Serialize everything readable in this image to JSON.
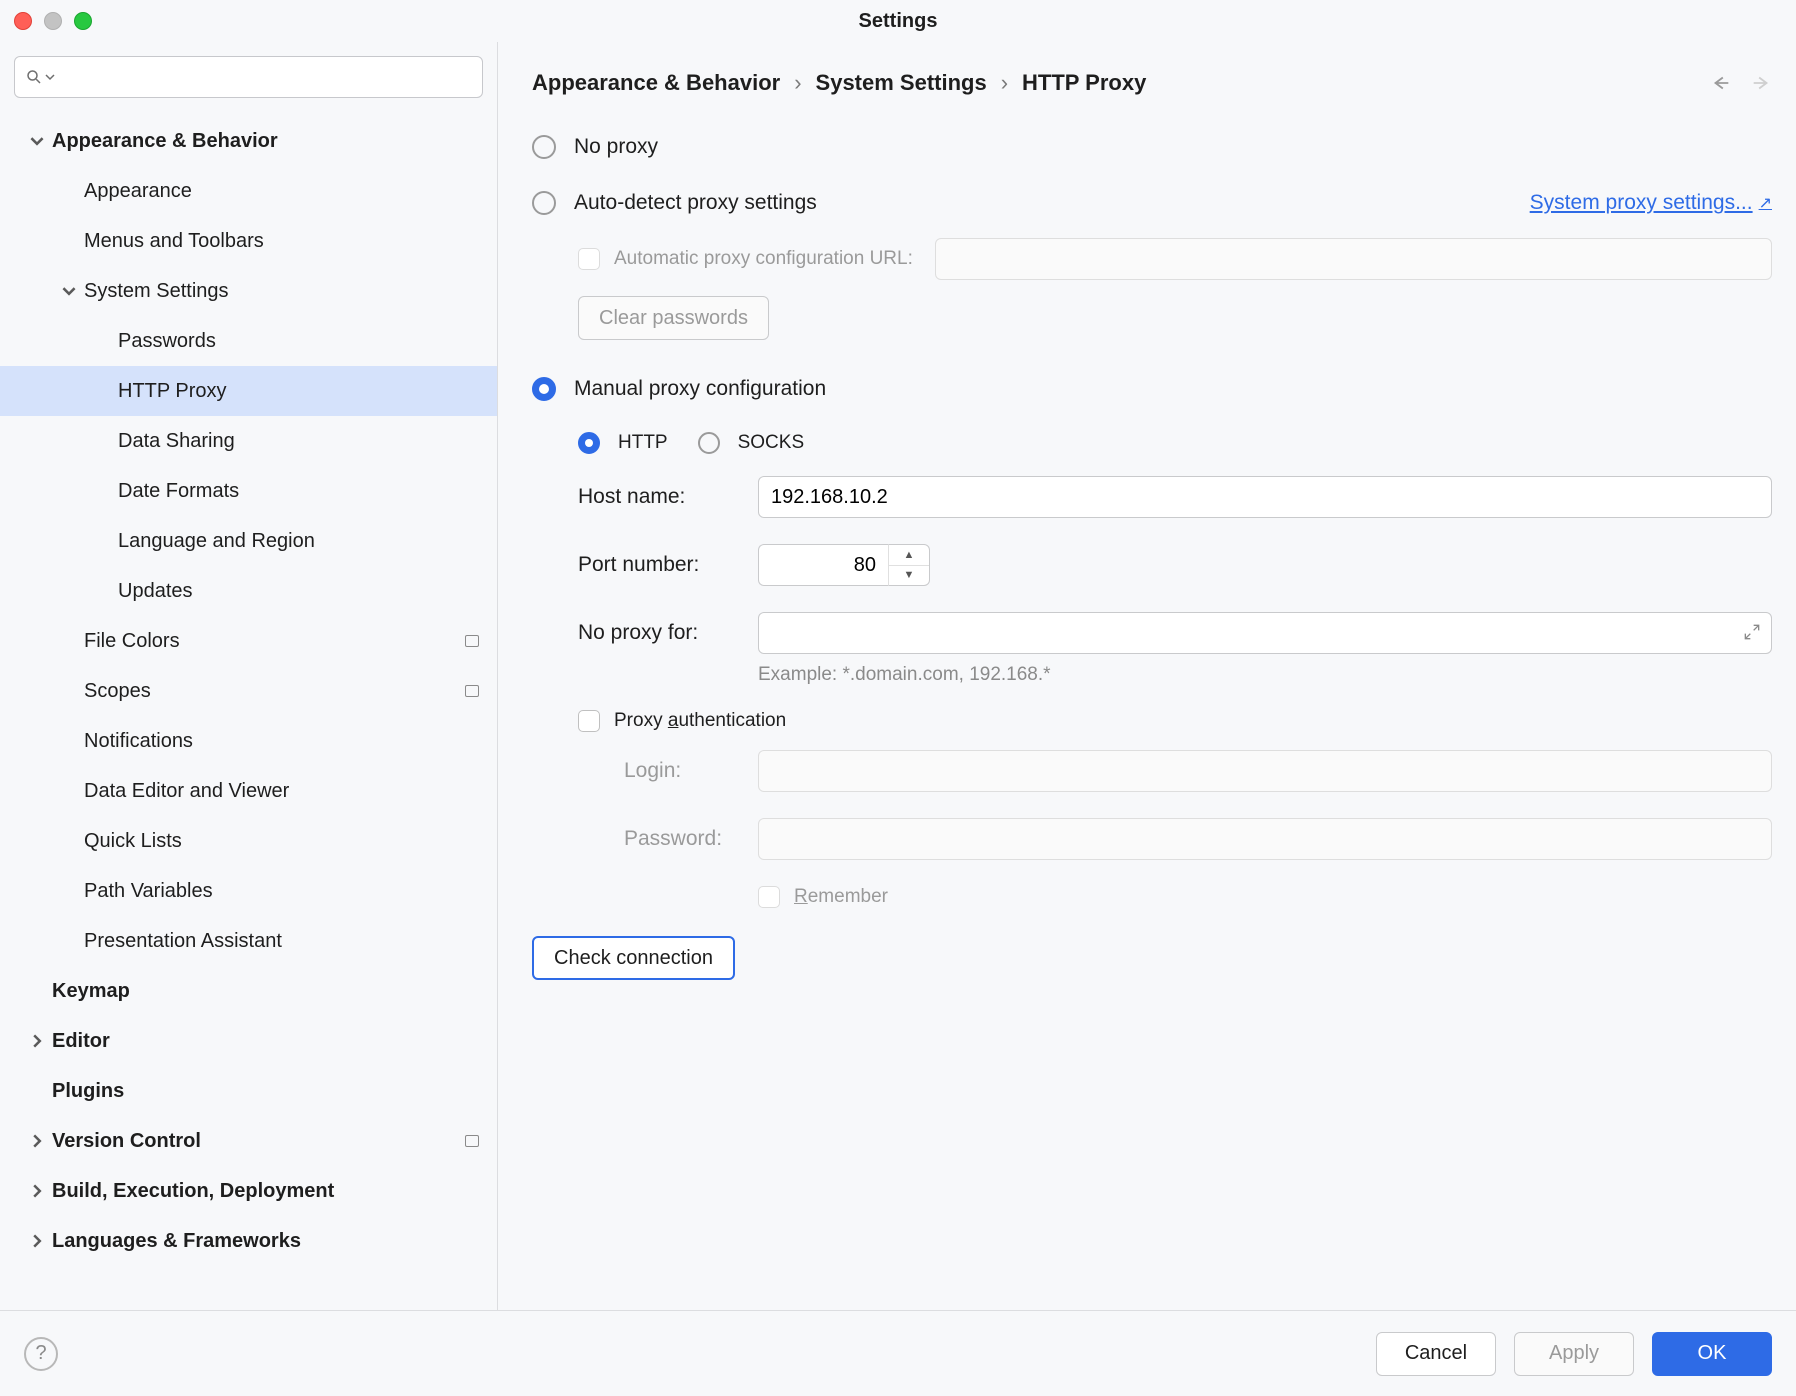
{
  "window": {
    "title": "Settings"
  },
  "sidebar": {
    "search_placeholder": "",
    "items": [
      {
        "label": "Appearance & Behavior",
        "bold": true,
        "indent": 0,
        "chev": "down"
      },
      {
        "label": "Appearance",
        "indent": 1
      },
      {
        "label": "Menus and Toolbars",
        "indent": 1
      },
      {
        "label": "System Settings",
        "indent": 1,
        "chev": "down"
      },
      {
        "label": "Passwords",
        "indent": 2
      },
      {
        "label": "HTTP Proxy",
        "indent": 2,
        "selected": true
      },
      {
        "label": "Data Sharing",
        "indent": 2
      },
      {
        "label": "Date Formats",
        "indent": 2
      },
      {
        "label": "Language and Region",
        "indent": 2
      },
      {
        "label": "Updates",
        "indent": 2
      },
      {
        "label": "File Colors",
        "indent": 1,
        "badge": true
      },
      {
        "label": "Scopes",
        "indent": 1,
        "badge": true
      },
      {
        "label": "Notifications",
        "indent": 1
      },
      {
        "label": "Data Editor and Viewer",
        "indent": 1
      },
      {
        "label": "Quick Lists",
        "indent": 1
      },
      {
        "label": "Path Variables",
        "indent": 1
      },
      {
        "label": "Presentation Assistant",
        "indent": 1
      },
      {
        "label": "Keymap",
        "bold": true,
        "indent": 0
      },
      {
        "label": "Editor",
        "bold": true,
        "indent": 0,
        "chev": "right"
      },
      {
        "label": "Plugins",
        "bold": true,
        "indent": 0
      },
      {
        "label": "Version Control",
        "bold": true,
        "indent": 0,
        "chev": "right",
        "badge": true
      },
      {
        "label": "Build, Execution, Deployment",
        "bold": true,
        "indent": 0,
        "chev": "right"
      },
      {
        "label": "Languages & Frameworks",
        "bold": true,
        "indent": 0,
        "chev": "right"
      }
    ]
  },
  "breadcrumbs": [
    "Appearance & Behavior",
    "System Settings",
    "HTTP Proxy"
  ],
  "proxy": {
    "no_proxy_label": "No proxy",
    "auto_detect_label": "Auto-detect proxy settings",
    "system_proxy_link": "System proxy settings...",
    "pac_checkbox_label": "Automatic proxy configuration URL:",
    "clear_passwords_label": "Clear passwords",
    "manual_label": "Manual proxy configuration",
    "type_http_label": "HTTP",
    "type_socks_label": "SOCKS",
    "selected_mode": "manual",
    "selected_type": "http",
    "host_label": "Host name:",
    "host_value": "192.168.10.2",
    "port_label": "Port number:",
    "port_value": "80",
    "noproxyfor_label": "No proxy for:",
    "noproxyfor_value": "",
    "noproxy_example": "Example: *.domain.com, 192.168.*",
    "auth_label_prefix": "Proxy ",
    "auth_label_u": "a",
    "auth_label_suffix": "uthentication",
    "login_label": "Login:",
    "password_label": "Password:",
    "remember_u": "R",
    "remember_suffix": "emember",
    "check_connection_label": "Check connection"
  },
  "footer": {
    "cancel": "Cancel",
    "apply": "Apply",
    "ok": "OK"
  }
}
